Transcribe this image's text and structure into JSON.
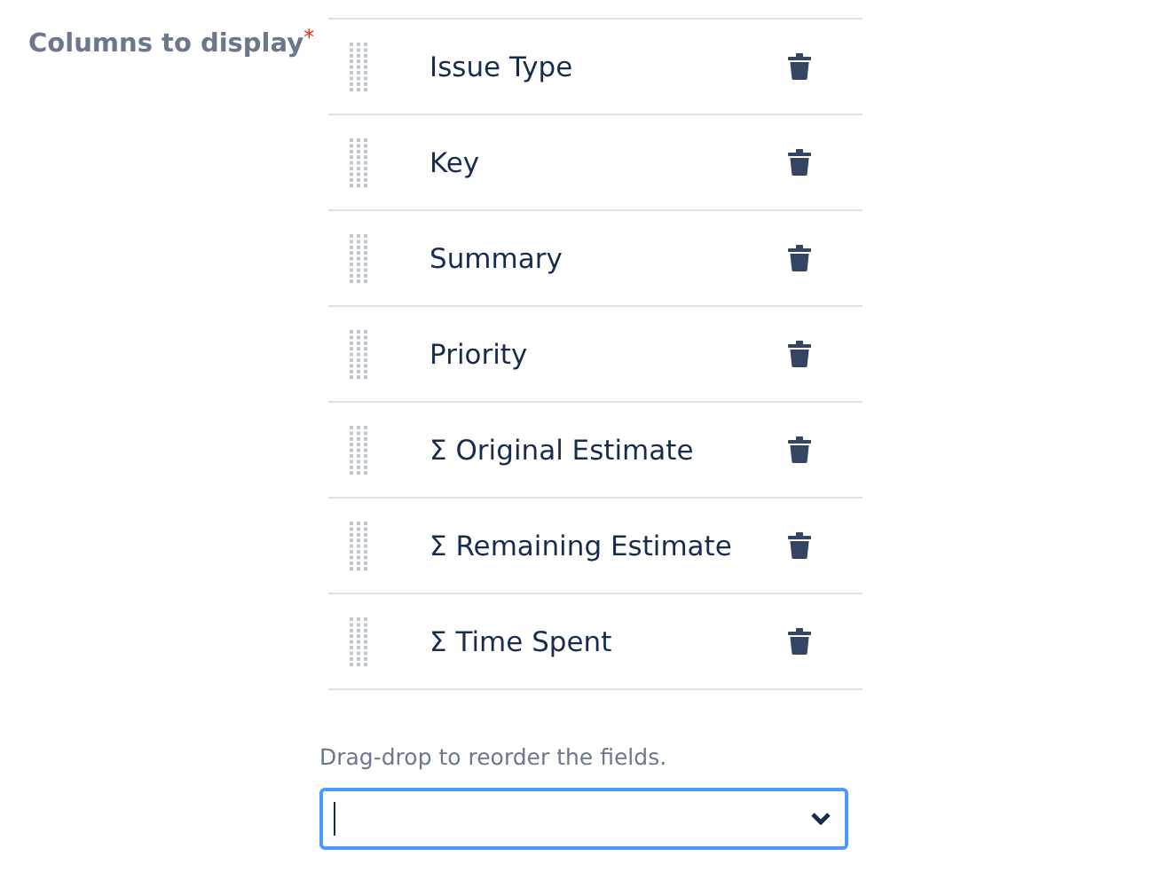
{
  "field": {
    "label": "Columns to display",
    "required_mark": "*"
  },
  "columns": [
    {
      "name": "Issue Type"
    },
    {
      "name": "Key"
    },
    {
      "name": "Summary"
    },
    {
      "name": "Priority"
    },
    {
      "name": "Σ Original Estimate"
    },
    {
      "name": "Σ Remaining Estimate"
    },
    {
      "name": "Σ Time Spent"
    }
  ],
  "help_text": "Drag-drop to reorder the fields.",
  "add_field": {
    "focused": true
  }
}
